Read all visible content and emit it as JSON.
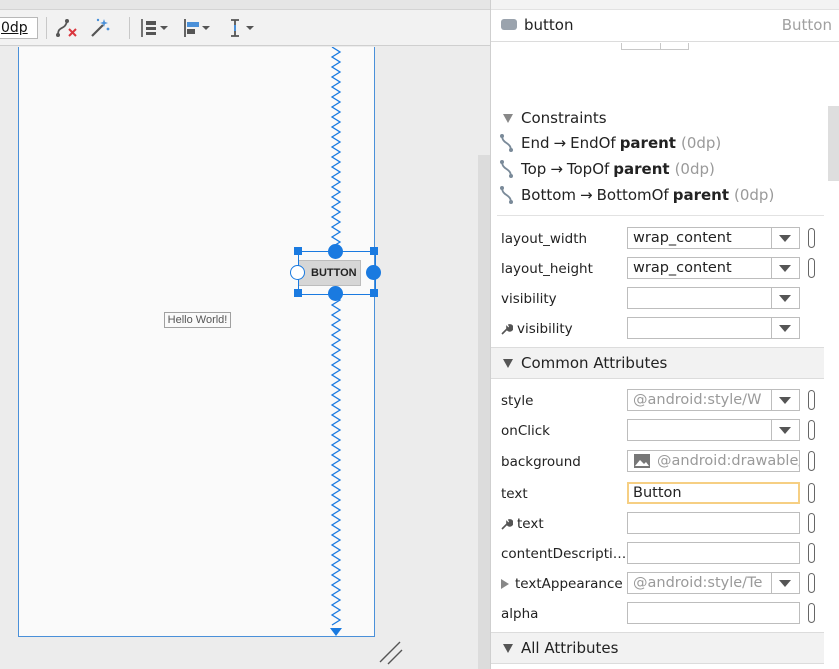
{
  "toolbar": {
    "margin_value": "0dp",
    "icons": [
      "constraint-clear-icon",
      "magic-wand-icon",
      "distribute-icon",
      "align-icon",
      "guideline-icon"
    ]
  },
  "canvas": {
    "hello_world_text": "Hello World!",
    "button_text": "BUTTON"
  },
  "attributes": {
    "component_name": "button",
    "component_type": "Button",
    "constraints_title": "Constraints",
    "constraints": [
      {
        "side": "End",
        "target": "EndOf",
        "parent": "parent",
        "margin": "(0dp)"
      },
      {
        "side": "Top",
        "target": "TopOf",
        "parent": "parent",
        "margin": "(0dp)"
      },
      {
        "side": "Bottom",
        "target": "BottomOf",
        "parent": "parent",
        "margin": "(0dp)"
      }
    ],
    "arrow": "→",
    "layout": [
      {
        "label": "layout_width",
        "value": "wrap_content"
      },
      {
        "label": "layout_height",
        "value": "wrap_content"
      },
      {
        "label": "visibility",
        "value": ""
      },
      {
        "label": "visibility",
        "value": ""
      }
    ],
    "common_title": "Common Attributes",
    "common": [
      {
        "label": "style",
        "value": "@android:style/W"
      },
      {
        "label": "onClick",
        "value": ""
      },
      {
        "label": "background",
        "value": "@android:drawable/"
      },
      {
        "label": "text",
        "value": "Button"
      },
      {
        "label": "text",
        "value": ""
      },
      {
        "label": "contentDescripti…",
        "value": ""
      },
      {
        "label": "textAppearance",
        "value": "@android:style/Te"
      },
      {
        "label": "alpha",
        "value": ""
      }
    ],
    "all_title": "All Attributes"
  },
  "colors": {
    "accent": "#1a7ae0",
    "focus": "#f6cf83"
  }
}
